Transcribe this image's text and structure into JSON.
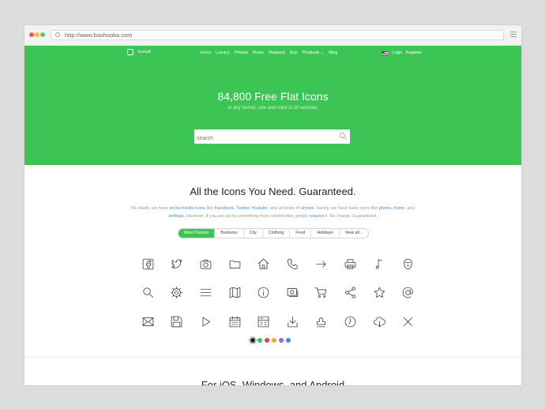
{
  "browser": {
    "url": "http://www.bashooka.com",
    "dot_colors": [
      "#ee5a52",
      "#f6bf3f",
      "#5ccd5f"
    ]
  },
  "nav": {
    "brand": "Icons8",
    "links": [
      "Icons",
      "Lunacy",
      "Photos",
      "Music",
      "Request",
      "Buy",
      "Products",
      "Blog"
    ],
    "products_caret": "⌄",
    "login": "Login",
    "register": "Register"
  },
  "hero": {
    "title": "84,800 Free Flat Icons",
    "subtitle": "in any format, size and color in 20 seconds",
    "search_placeholder": "search",
    "background": "#3cc454"
  },
  "section": {
    "title": "All the Icons You Need. Guaranteed.",
    "desc": {
      "t1": "No doubt, we have ",
      "l1": "social media icons",
      "t2": " like ",
      "l2": "Facebook",
      "t3": ", ",
      "l3": "Twitter",
      "t4": ", ",
      "l4": "Youtube",
      "t5": ", and all kinds of ",
      "l5": "arrows",
      "t6": ". Surely, we have basic ones like ",
      "l6": "phone",
      "t7": ", ",
      "l7": "home",
      "t8": ", and ",
      "l8": "settings",
      "t9": ". However, if you are up for something more unorthodox, simply ",
      "l9": "request",
      "t10": " it. No charge. Guaranteed."
    }
  },
  "filters": [
    "Most Popular",
    "Business",
    "City",
    "Clothing",
    "Food",
    "Holidays",
    "View all..."
  ],
  "icons": [
    "facebook-icon",
    "twitter-icon",
    "camera-icon",
    "folder-icon",
    "home-icon",
    "phone-icon",
    "arrow-right-icon",
    "printer-icon",
    "music-note-icon",
    "user-icon",
    "search-icon",
    "settings-icon",
    "menu-icon",
    "map-icon",
    "info-icon",
    "money-icon",
    "cart-icon",
    "share-icon",
    "star-icon",
    "at-sign-icon",
    "mail-icon",
    "save-icon",
    "play-icon",
    "calendar-icon",
    "calculator-icon",
    "download-icon",
    "stamp-icon",
    "clock-icon",
    "cloud-download-icon",
    "close-icon"
  ],
  "color_swatches": [
    "#222222",
    "#3cc454",
    "#e83b3b",
    "#f2a81e",
    "#a55ed8",
    "#3f8ee0"
  ],
  "next_section_title": "For iOS, Windows, and Android"
}
